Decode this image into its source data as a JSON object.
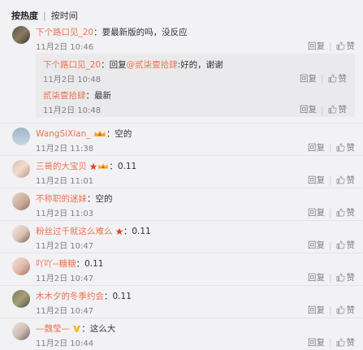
{
  "sort": {
    "hot": "按热度",
    "time": "按时间"
  },
  "actions": {
    "reply": "回复",
    "like": "赞"
  },
  "thread": {
    "user": "下个路口见_20",
    "text": "：要最新版的吗，没反应",
    "time": "11月2日 10:46",
    "replies": [
      {
        "user": "下个路口见_20",
        "prefix": "：回复",
        "mention": "@贰柒壹拾肆",
        "text": ":好的，谢谢",
        "time": "11月2日 10:48"
      },
      {
        "user": "贰柒壹拾肆",
        "prefix": "",
        "mention": "",
        "text": "：最新",
        "time": "11月2日 10:48"
      }
    ]
  },
  "comments": [
    {
      "user": "WangSiXian_",
      "text": "：空的",
      "time": "11月2日 11:38",
      "badge": "crown"
    },
    {
      "user": "三哥的大宝贝",
      "text": "：0.11",
      "time": "11月2日 11:01",
      "badge": "star-crown"
    },
    {
      "user": "不称职的迷妹",
      "text": "：空的",
      "time": "11月2日 11:03",
      "badge": ""
    },
    {
      "user": "粉丝过千就这么难么",
      "text": "：0.11",
      "time": "11月2日 10:47",
      "badge": "star"
    },
    {
      "user": "吖吖--糖糖",
      "text": "：0.11",
      "time": "11月2日 10:47",
      "badge": ""
    },
    {
      "user": "木木夕的冬季约会",
      "text": "：0.11",
      "time": "11月2日 10:47",
      "badge": ""
    },
    {
      "user": "—魏莹—",
      "text": "：这么大",
      "time": "11月2日 10:44",
      "badge": "v"
    }
  ],
  "colors": {
    "username": "#eb7350",
    "time": "#808080",
    "bg": "#f2f2f5"
  }
}
